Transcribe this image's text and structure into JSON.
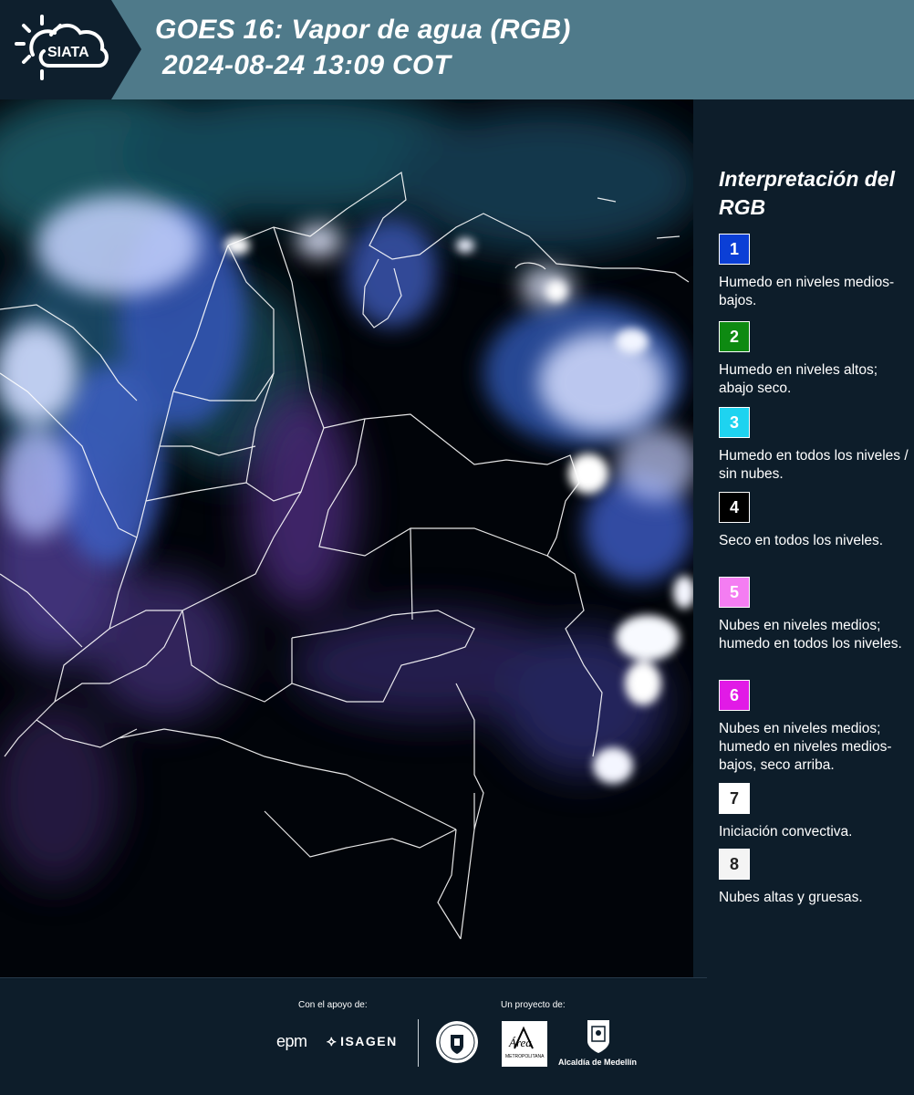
{
  "header": {
    "logo_text": "SIATA",
    "title_line1": "GOES 16: Vapor de agua (RGB)",
    "title_line2": "2024-08-24 13:09 COT"
  },
  "legend": {
    "title": "Interpretación del RGB",
    "items": [
      {
        "number": "1",
        "text": "Humedo en niveles medios-bajos.",
        "color": "#0b3fd6",
        "text_color": "#ffffff"
      },
      {
        "number": "2",
        "text": "Humedo en niveles altos; abajo seco.",
        "color": "#0e8a12",
        "text_color": "#ffffff"
      },
      {
        "number": "3",
        "text": "Humedo en todos los niveles / sin nubes.",
        "color": "#1ed3f0",
        "text_color": "#ffffff"
      },
      {
        "number": "4",
        "text": "Seco en todos los niveles.",
        "color": "#000000",
        "text_color": "#ffffff"
      },
      {
        "number": "5",
        "text": "Nubes en niveles medios; humedo en todos los niveles.",
        "color": "#f47df2",
        "text_color": "#ffffff"
      },
      {
        "number": "6",
        "text": "Nubes en niveles medios; humedo en niveles medios-bajos, seco arriba.",
        "color": "#e11ae6",
        "text_color": "#ffffff"
      },
      {
        "number": "7",
        "text": "Iniciación convectiva.",
        "color": "#ffffff",
        "text_color": "#222222"
      },
      {
        "number": "8",
        "text": "Nubes altas y gruesas.",
        "color": "#f4f4f4",
        "text_color": "#222222"
      }
    ]
  },
  "footer": {
    "support_label": "Con el apoyo de:",
    "project_label": "Un proyecto de:",
    "sponsor1": "epm",
    "sponsor2": "ISAGEN",
    "amva_text": "Área",
    "amva_sub": "METROPOLITANA",
    "alcaldia": "Alcaldía de Medellín"
  },
  "colors": {
    "header_bg": "#4f7a8a",
    "panel_bg": "#0d1d2a",
    "map_bg": "#010409"
  }
}
